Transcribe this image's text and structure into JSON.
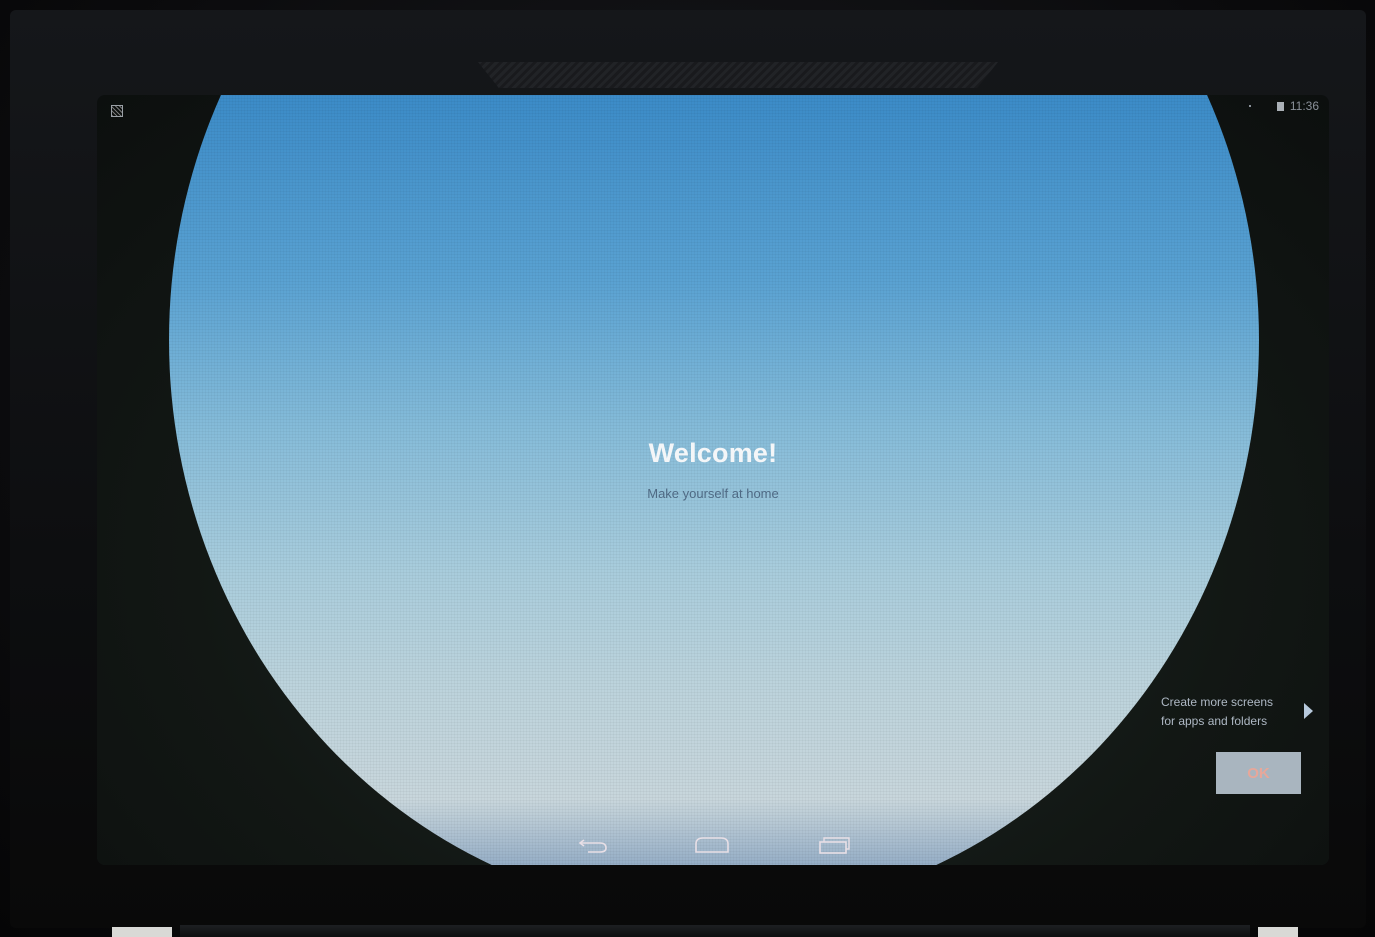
{
  "status_bar": {
    "time": "11:36",
    "notification_icon": "screenshot-notification-icon",
    "battery_icon": "battery-icon"
  },
  "welcome": {
    "title": "Welcome!",
    "subtitle": "Make yourself at home"
  },
  "cling": {
    "hint_line1": "Create more screens",
    "hint_line2": "for apps and folders",
    "ok_label": "OK"
  },
  "nav_bar": {
    "back_icon": "back-arrow-icon",
    "home_icon": "home-icon",
    "recents_icon": "recent-apps-icon"
  },
  "colors": {
    "welcome_gradient_top": "#2f7fbf",
    "welcome_gradient_bottom": "#c8d6dc",
    "ok_button_text": "#e7a79a"
  }
}
